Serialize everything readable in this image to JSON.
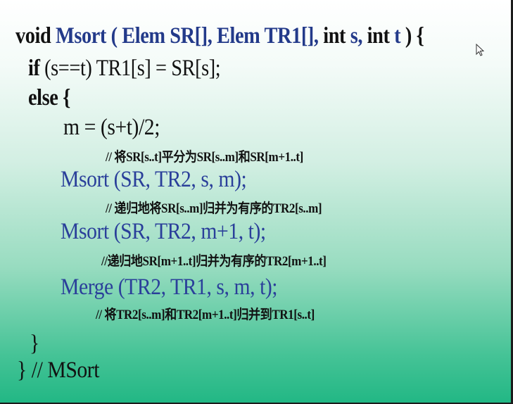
{
  "code": {
    "l1_kw_void": "void",
    "l1_signature": "Msort ( Elem SR[], Elem TR1[],",
    "l1_kw_int1": "int",
    "l1_s": "s,",
    "l1_kw_int2": "int",
    "l1_t": "t",
    "l1_close": ") {",
    "l2_if": "if",
    "l2_body": "(s==t)  TR1[s] = SR[s];",
    "l3_else": "else {",
    "l4_assign": "m = (s+t)/2;",
    "l5_comment": "// 将SR[s..t]平分为SR[s..m]和SR[m+1..t]",
    "l6_call": "Msort (SR, TR2, s, m);",
    "l7_comment": "// 递归地将SR[s..m]归并为有序的TR2[s..m]",
    "l8_call": "Msort (SR, TR2, m+1, t);",
    "l9_comment": "//递归地SR[m+1..t]归并为有序的TR2[m+1..t]",
    "l10_call": "Merge (TR2, TR1, s, m, t);",
    "l11_comment": "// 将TR2[s..m]和TR2[m+1..t]归并到TR1[s..t]",
    "l12_brace": "}",
    "l13_end": "} // MSort"
  }
}
